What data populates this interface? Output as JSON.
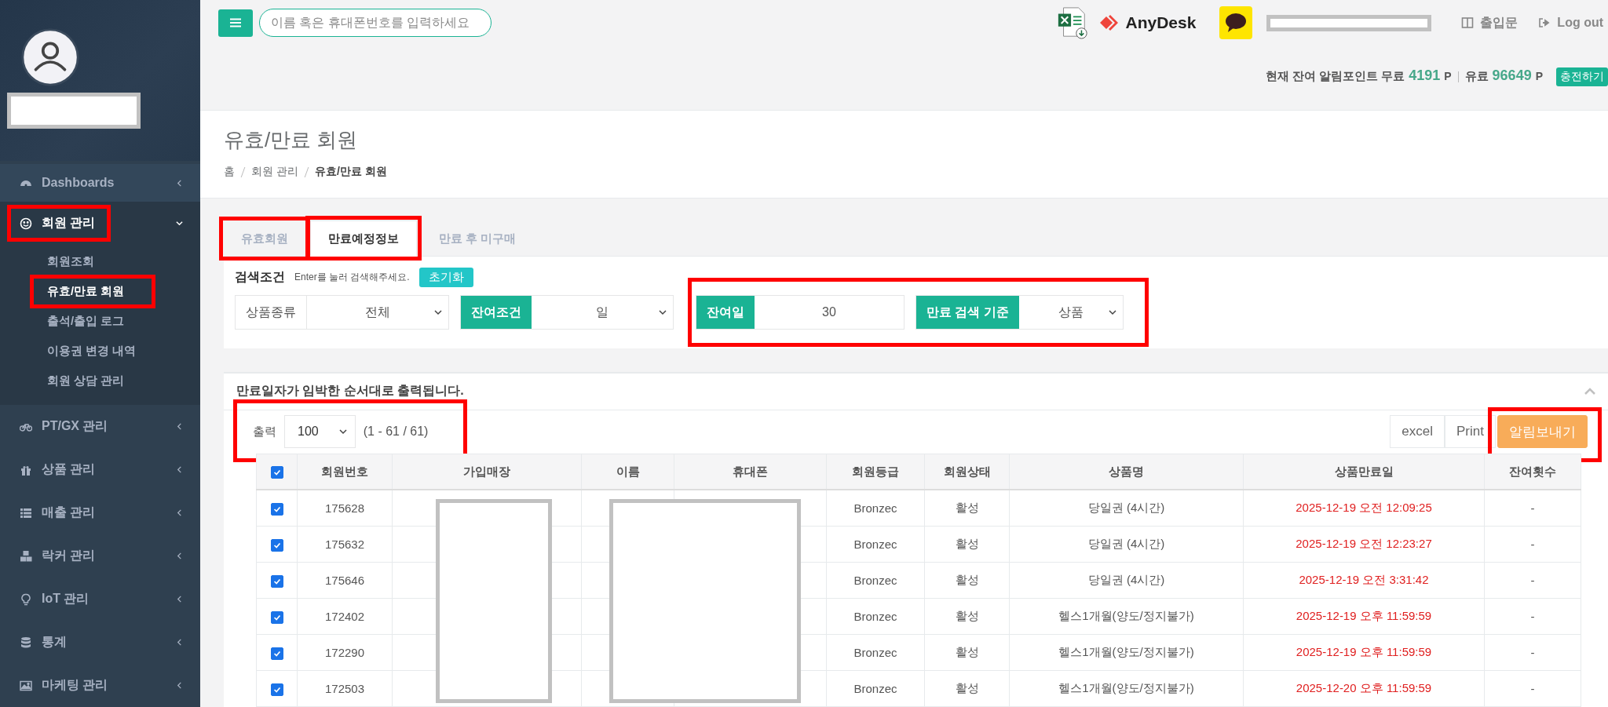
{
  "topbar": {
    "search": {
      "placeholder": "이름 혹은 휴대폰번호를 입력하세요"
    },
    "brand": "AnyDesk",
    "links": [
      {
        "label": "출입문"
      },
      {
        "label": "Log out"
      }
    ],
    "points": {
      "prefix": "현재 잔여 알림포인트 무료",
      "free": "4191",
      "free_unit": "P",
      "paid_label": "유료",
      "paid": "96649",
      "paid_unit": "P",
      "charge": "충전하기"
    }
  },
  "sidebar": {
    "items": [
      {
        "label": "Dashboards",
        "expanded": false,
        "highlighted": false
      },
      {
        "label": "회원 관리",
        "expanded": true,
        "highlighted": true,
        "children": [
          {
            "label": "회원조회",
            "selected": false,
            "highlighted": false
          },
          {
            "label": "유효/만료 회원",
            "selected": true,
            "highlighted": true
          },
          {
            "label": "출석/출입 로그",
            "selected": false,
            "highlighted": false
          },
          {
            "label": "이용권 변경 내역",
            "selected": false,
            "highlighted": false
          },
          {
            "label": "회원 상담 관리",
            "selected": false,
            "highlighted": false
          }
        ]
      },
      {
        "label": "PT/GX 관리",
        "expanded": false,
        "highlighted": false
      },
      {
        "label": "상품 관리",
        "expanded": false,
        "highlighted": false
      },
      {
        "label": "매출 관리",
        "expanded": false,
        "highlighted": false
      },
      {
        "label": "락커 관리",
        "expanded": false,
        "highlighted": false
      },
      {
        "label": "IoT 관리",
        "expanded": false,
        "highlighted": false
      },
      {
        "label": "통계",
        "expanded": false,
        "highlighted": false
      },
      {
        "label": "마케팅 관리",
        "expanded": false,
        "highlighted": false
      }
    ]
  },
  "page": {
    "title": "유효/만료 회원",
    "breadcrumb": [
      "홈",
      "회원 관리",
      "유효/만료 회원"
    ]
  },
  "tabs": [
    {
      "label": "유효회원",
      "selected": false,
      "highlighted": true
    },
    {
      "label": "만료예정정보",
      "selected": true,
      "highlighted": true
    },
    {
      "label": "만료 후 미구매",
      "selected": false,
      "highlighted": false
    }
  ],
  "search": {
    "title": "검색조건",
    "hint": "Enter를 눌러 검색해주세요.",
    "reset": "초기화",
    "groups": [
      {
        "highlighted": false,
        "filters": [
          {
            "label": "상품종류",
            "accent": false,
            "kind": "select",
            "value": "전체"
          },
          {
            "label": "잔여조건",
            "accent": true,
            "kind": "select",
            "value": "일"
          }
        ]
      },
      {
        "highlighted": true,
        "filters": [
          {
            "label": "잔여일",
            "accent": true,
            "kind": "input",
            "value": "30"
          },
          {
            "label": "만료 검색 기준",
            "accent": true,
            "kind": "select",
            "value": "상품"
          }
        ]
      }
    ]
  },
  "results": {
    "notice": "만료일자가 임박한 순서대로 출력됩니다.",
    "page_size": {
      "label": "출력",
      "value": "100",
      "range": "(1 - 61 / 61)",
      "highlighted": true
    },
    "actions": [
      {
        "label": "excel",
        "kind": "default",
        "highlighted": false
      },
      {
        "label": "Print",
        "kind": "default",
        "highlighted": false
      },
      {
        "label": "알림보내기",
        "kind": "warning",
        "highlighted": true
      }
    ],
    "table": {
      "all_selected": true,
      "columns": [
        "회원번호",
        "가입매장",
        "이름",
        "휴대폰",
        "회원등급",
        "회원상태",
        "상품명",
        "상품만료일",
        "잔여횟수"
      ],
      "rows": [
        {
          "selected": true,
          "number": "175628",
          "grade": "Bronzec",
          "status": "활성",
          "product": "당일권 (4시간)",
          "expires": "2025-12-19 오전 12:09:25",
          "remaining": "-"
        },
        {
          "selected": true,
          "number": "175632",
          "grade": "Bronzec",
          "status": "활성",
          "product": "당일권 (4시간)",
          "expires": "2025-12-19 오전 12:23:27",
          "remaining": "-"
        },
        {
          "selected": true,
          "number": "175646",
          "grade": "Bronzec",
          "status": "활성",
          "product": "당일권 (4시간)",
          "expires": "2025-12-19 오전 3:31:42",
          "remaining": "-"
        },
        {
          "selected": true,
          "number": "172402",
          "grade": "Bronzec",
          "status": "활성",
          "product": "헬스1개월(양도/정지불가)",
          "expires": "2025-12-19 오후 11:59:59",
          "remaining": "-"
        },
        {
          "selected": true,
          "number": "172290",
          "grade": "Bronzec",
          "status": "활성",
          "product": "헬스1개월(양도/정지불가)",
          "expires": "2025-12-19 오후 11:59:59",
          "remaining": "-"
        },
        {
          "selected": true,
          "number": "172503",
          "grade": "Bronzec",
          "status": "활성",
          "product": "헬스1개월(양도/정지불가)",
          "expires": "2025-12-20 오후 11:59:59",
          "remaining": "-"
        }
      ]
    }
  }
}
